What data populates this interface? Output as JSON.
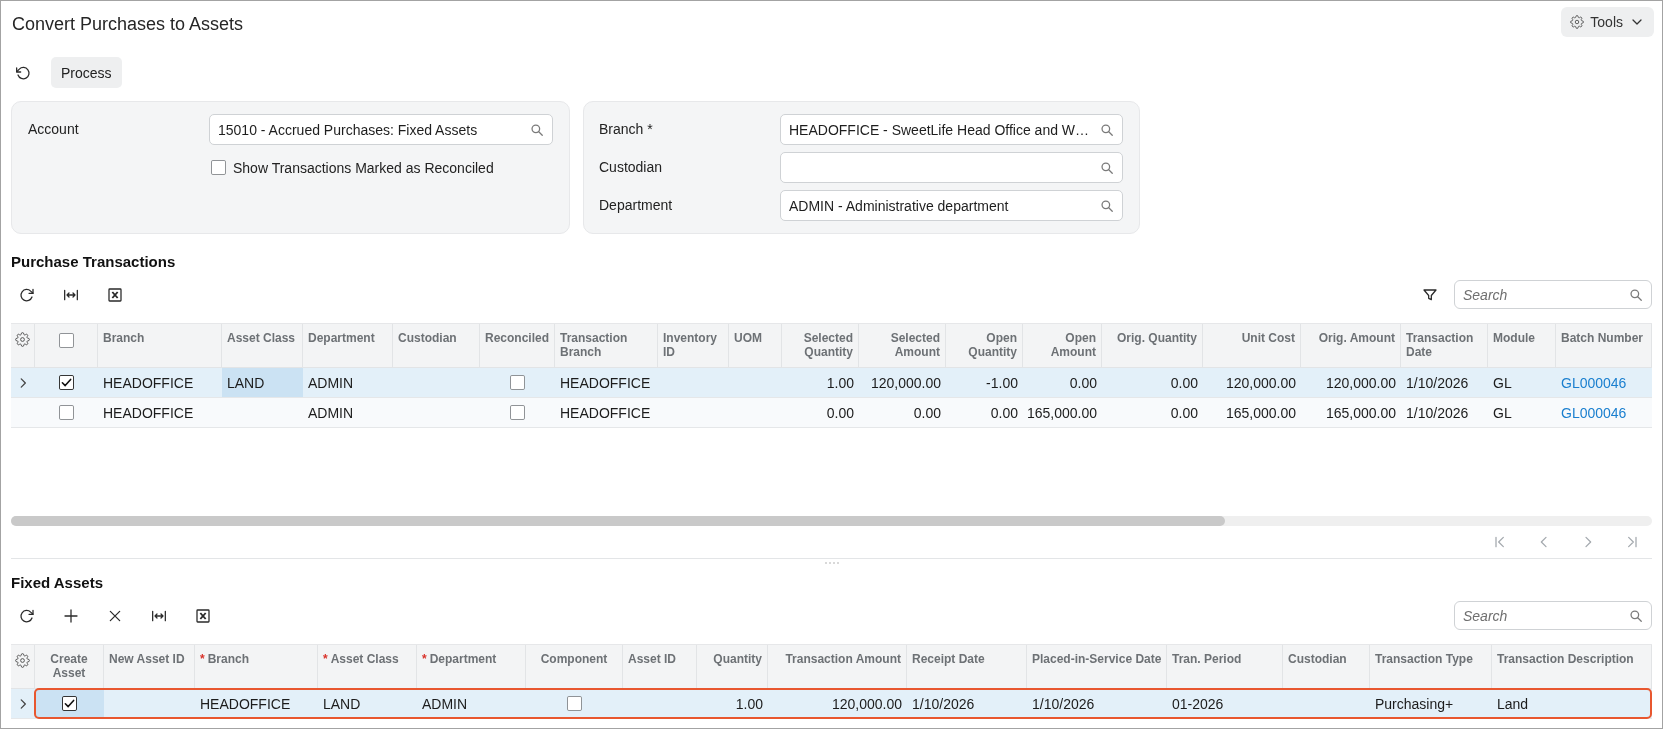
{
  "page": {
    "title": "Convert Purchases to Assets",
    "tools_label": "Tools"
  },
  "toolbar": {
    "process_label": "Process"
  },
  "filters": {
    "left": [
      {
        "kind": "lookup",
        "label": "Account",
        "value": "15010 - Accrued Purchases: Fixed Assets"
      },
      {
        "kind": "checkbox",
        "label": "Show Transactions Marked as Reconciled",
        "checked": false
      }
    ],
    "right": [
      {
        "kind": "lookup",
        "label": "Branch *",
        "value": "HEADOFFICE - SweetLife Head Office and W…"
      },
      {
        "kind": "lookup",
        "label": "Custodian"
      },
      {
        "kind": "lookup",
        "label": "Department",
        "value": "ADMIN - Administrative department"
      }
    ]
  },
  "purchase_transactions": {
    "title": "Purchase Transactions",
    "search": {
      "placeholder": "Search"
    },
    "columns": [
      {
        "kind": "select_all",
        "checked": false
      },
      {
        "kind": "text",
        "label": "Branch"
      },
      {
        "kind": "text",
        "label": "Asset Class"
      },
      {
        "kind": "text",
        "label": "Department"
      },
      {
        "kind": "text",
        "label": "Custodian"
      },
      {
        "kind": "checkbox",
        "label": "Reconciled"
      },
      {
        "kind": "text",
        "label": "Transaction Branch"
      },
      {
        "kind": "text",
        "label": "Inventory ID"
      },
      {
        "kind": "text",
        "label": "UOM"
      },
      {
        "kind": "number",
        "label": "Selected Quantity"
      },
      {
        "kind": "number",
        "label": "Selected Amount"
      },
      {
        "kind": "number",
        "label": "Open Quantity"
      },
      {
        "kind": "number",
        "label": "Open Amount"
      },
      {
        "kind": "number",
        "label": "Orig. Quantity"
      },
      {
        "kind": "number",
        "label": "Unit Cost"
      },
      {
        "kind": "number",
        "label": "Orig. Amount"
      },
      {
        "kind": "text",
        "label": "Transaction Date"
      },
      {
        "kind": "text",
        "label": "Module"
      },
      {
        "kind": "link",
        "label": "Batch Number"
      }
    ],
    "rows": [
      {
        "selected": true,
        "cells": [
          {
            "checked": true,
            "focused": false
          },
          {
            "text": "HEADOFFICE",
            "focused": false
          },
          {
            "text": "LAND",
            "focused": true
          },
          {
            "text": "ADMIN",
            "focused": false
          },
          {
            "focused": false
          },
          {
            "checked": false,
            "focused": false
          },
          {
            "text": "HEADOFFICE",
            "focused": false
          },
          {
            "focused": false
          },
          {
            "focused": false
          },
          {
            "text": "1.00",
            "focused": false
          },
          {
            "text": "120,000.00",
            "focused": false
          },
          {
            "text": "-1.00",
            "focused": false
          },
          {
            "text": "0.00",
            "focused": false
          },
          {
            "text": "0.00",
            "focused": false
          },
          {
            "text": "120,000.00",
            "focused": false
          },
          {
            "text": "120,000.00",
            "focused": false
          },
          {
            "text": "1/10/2026",
            "focused": false
          },
          {
            "text": "GL",
            "focused": false
          },
          {
            "text": "GL000046",
            "focused": false
          }
        ]
      },
      {
        "selected": false,
        "cells": [
          {
            "checked": false,
            "focused": false
          },
          {
            "text": "HEADOFFICE",
            "focused": false
          },
          {
            "focused": false
          },
          {
            "text": "ADMIN",
            "focused": false
          },
          {
            "focused": false
          },
          {
            "checked": false,
            "focused": false
          },
          {
            "text": "HEADOFFICE",
            "focused": false
          },
          {
            "focused": false
          },
          {
            "focused": false
          },
          {
            "text": "0.00",
            "focused": false
          },
          {
            "text": "0.00",
            "focused": false
          },
          {
            "text": "0.00",
            "focused": false
          },
          {
            "text": "165,000.00",
            "focused": false
          },
          {
            "text": "0.00",
            "focused": false
          },
          {
            "text": "165,000.00",
            "focused": false
          },
          {
            "text": "165,000.00",
            "focused": false
          },
          {
            "text": "1/10/2026",
            "focused": false
          },
          {
            "text": "GL",
            "focused": false
          },
          {
            "text": "GL000046",
            "focused": false
          }
        ]
      }
    ],
    "pager": {
      "disabled": true
    }
  },
  "fixed_assets": {
    "title": "Fixed Assets",
    "search": {
      "placeholder": "Search"
    },
    "columns": [
      {
        "kind": "checkbox",
        "label": "Create Asset"
      },
      {
        "kind": "text",
        "label": "New Asset ID"
      },
      {
        "kind": "text",
        "label": "Branch",
        "mark": "*"
      },
      {
        "kind": "text",
        "label": "Asset Class",
        "mark": "*"
      },
      {
        "kind": "text",
        "label": "Department",
        "mark": "*"
      },
      {
        "kind": "checkbox",
        "label": "Component"
      },
      {
        "kind": "text",
        "label": "Asset ID"
      },
      {
        "kind": "number",
        "label": "Quantity"
      },
      {
        "kind": "number",
        "label": "Transaction Amount"
      },
      {
        "kind": "text",
        "label": "Receipt Date"
      },
      {
        "kind": "text",
        "label": "Placed-in-Service Date"
      },
      {
        "kind": "text",
        "label": "Tran. Period"
      },
      {
        "kind": "text",
        "label": "Custodian"
      },
      {
        "kind": "text",
        "label": "Transaction Type"
      },
      {
        "kind": "text",
        "label": "Transaction Description"
      }
    ],
    "rows": [
      {
        "selected": true,
        "highlighted": true,
        "cells": [
          {
            "checked": true,
            "focused": true
          },
          {
            "focused": false
          },
          {
            "text": "HEADOFFICE",
            "focused": false
          },
          {
            "text": "LAND",
            "focused": false
          },
          {
            "text": "ADMIN",
            "focused": false
          },
          {
            "checked": false,
            "focused": false
          },
          {
            "focused": false
          },
          {
            "text": "1.00",
            "focused": false
          },
          {
            "text": "120,000.00",
            "focused": false
          },
          {
            "text": "1/10/2026",
            "focused": false
          },
          {
            "text": "1/10/2026",
            "focused": false
          },
          {
            "text": "01-2026",
            "focused": false
          },
          {
            "focused": false
          },
          {
            "text": "Purchasing+",
            "focused": false
          },
          {
            "text": "Land",
            "focused": false
          }
        ]
      }
    ]
  }
}
